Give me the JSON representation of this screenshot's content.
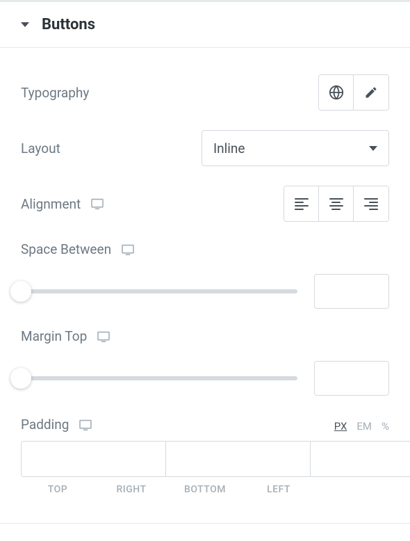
{
  "section": {
    "title": "Buttons"
  },
  "typography": {
    "label": "Typography"
  },
  "layout": {
    "label": "Layout",
    "value": "Inline"
  },
  "alignment": {
    "label": "Alignment"
  },
  "spaceBetween": {
    "label": "Space Between",
    "value": ""
  },
  "marginTop": {
    "label": "Margin Top",
    "value": ""
  },
  "padding": {
    "label": "Padding",
    "units": [
      "PX",
      "EM",
      "%"
    ],
    "activeUnit": "PX",
    "top": "",
    "right": "",
    "bottom": "",
    "left": "",
    "labels": {
      "top": "TOP",
      "right": "RIGHT",
      "bottom": "BOTTOM",
      "left": "LEFT"
    }
  }
}
